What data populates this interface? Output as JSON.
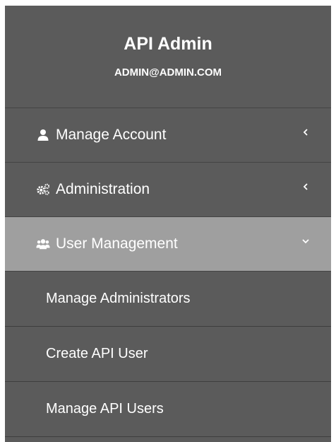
{
  "profile": {
    "name": "API Admin",
    "email": "ADMIN@ADMIN.COM"
  },
  "menu": [
    {
      "label": "Manage Account",
      "icon": "user-icon",
      "state": "collapsed"
    },
    {
      "label": "Administration",
      "icon": "gears-icon",
      "state": "collapsed"
    },
    {
      "label": "User Management",
      "icon": "users-icon",
      "state": "expanded"
    }
  ],
  "submenu": [
    {
      "label": "Manage Administrators"
    },
    {
      "label": "Create API User"
    },
    {
      "label": "Manage API Users"
    }
  ],
  "colors": {
    "sidebar_bg": "#5b5b5b",
    "active_bg": "#9f9f9f",
    "divider": "#444444",
    "text": "#ffffff"
  }
}
